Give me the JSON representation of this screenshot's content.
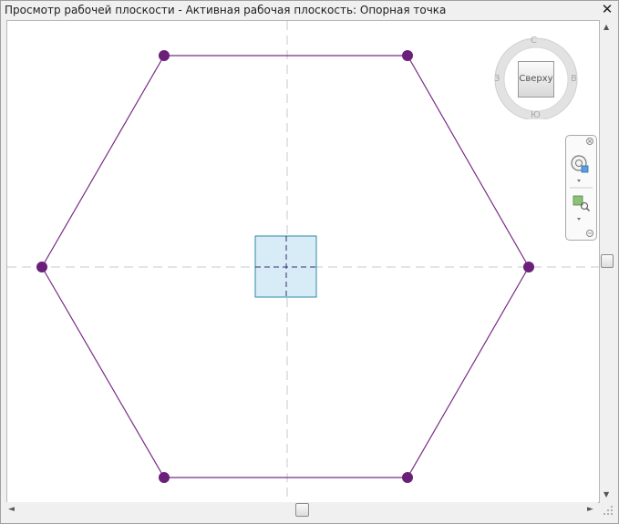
{
  "window": {
    "title": "Просмотр рабочей плоскости - Активная рабочая плоскость: Опорная точка",
    "close_glyph": "✕"
  },
  "viewcube": {
    "face_label": "Сверху",
    "compass_glyphs": {
      "north": "С",
      "south": "Ю",
      "east": "В",
      "west": "З"
    }
  },
  "colors": {
    "hexagon_line": "#7a2a86",
    "vertex_dot": "#6a1f78",
    "axis_dash": "#c8c8c8",
    "origin_fill": "#d7ecf6",
    "origin_border": "#2a8aa8"
  },
  "scrollbars": {
    "up_glyph": "▲",
    "down_glyph": "▼",
    "left_glyph": "◄",
    "right_glyph": "►"
  }
}
